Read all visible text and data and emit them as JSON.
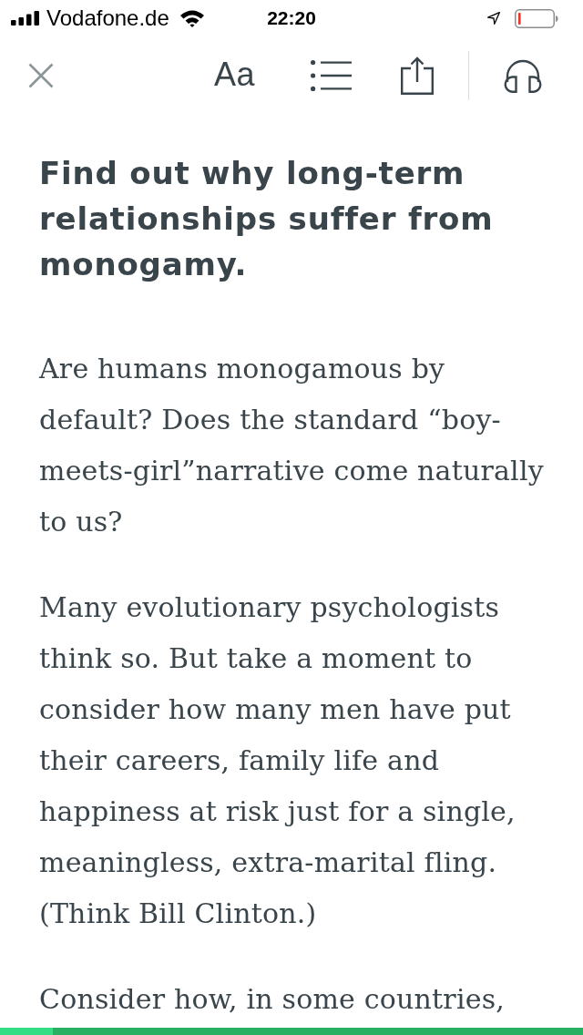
{
  "status_bar": {
    "carrier": "Vodafone.de",
    "time": "22:20"
  },
  "toolbar": {
    "font_button": "Aa"
  },
  "article": {
    "heading": "Find out why long-term relationships suffer from monogamy.",
    "paragraphs": [
      "Are humans monogamous by default? Does the standard “boy-meets-girl”narrative come naturally to us?",
      "Many evolutionary psychologists think so. But take a moment to consider how many men have put their careers, family life and happiness at risk just for a single, meaningless, extra-marital fling. (Think Bill Clinton.)",
      "Consider how, in some countries,"
    ]
  },
  "progress": {
    "level": 0.09
  }
}
